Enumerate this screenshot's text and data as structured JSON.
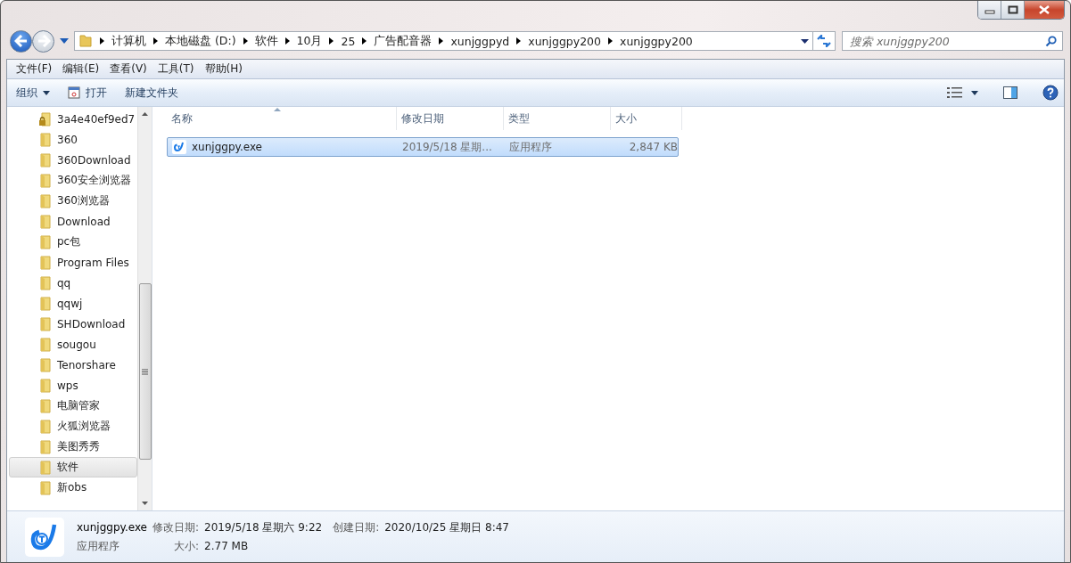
{
  "address_bar": {
    "crumbs": [
      "计算机",
      "本地磁盘 (D:)",
      "软件",
      "10月",
      "25",
      "广告配音器",
      "xunjggpyd",
      "xunjggpy200",
      "xunjggpy200"
    ]
  },
  "search": {
    "placeholder": "搜索 xunjggpy200"
  },
  "menu": [
    "文件(F)",
    "编辑(E)",
    "查看(V)",
    "工具(T)",
    "帮助(H)"
  ],
  "toolbar": [
    {
      "label": "组织",
      "kind": "dropdown"
    },
    {
      "label": "打开",
      "kind": "open"
    },
    {
      "label": "新建文件夹",
      "kind": "plain"
    }
  ],
  "sidebar": {
    "items": [
      {
        "label": "3a4e40ef9ed7",
        "kind": "locked",
        "selected": false
      },
      {
        "label": "360",
        "kind": "folder",
        "selected": false
      },
      {
        "label": "360Download",
        "kind": "folder",
        "selected": false
      },
      {
        "label": "360安全浏览器",
        "kind": "folder",
        "selected": false
      },
      {
        "label": "360浏览器",
        "kind": "folder",
        "selected": false
      },
      {
        "label": "Download",
        "kind": "folder",
        "selected": false
      },
      {
        "label": "pc包",
        "kind": "folder",
        "selected": false
      },
      {
        "label": "Program Files",
        "kind": "folder",
        "selected": false
      },
      {
        "label": "qq",
        "kind": "folder",
        "selected": false
      },
      {
        "label": "qqwj",
        "kind": "folder",
        "selected": false
      },
      {
        "label": "SHDownload",
        "kind": "folder",
        "selected": false
      },
      {
        "label": "sougou",
        "kind": "folder",
        "selected": false
      },
      {
        "label": "Tenorshare",
        "kind": "folder",
        "selected": false
      },
      {
        "label": "wps",
        "kind": "folder",
        "selected": false
      },
      {
        "label": "电脑管家",
        "kind": "folder",
        "selected": false
      },
      {
        "label": "火狐浏览器",
        "kind": "folder",
        "selected": false
      },
      {
        "label": "美图秀秀",
        "kind": "folder",
        "selected": false
      },
      {
        "label": "软件",
        "kind": "folder",
        "selected": true
      },
      {
        "label": "新obs",
        "kind": "folder",
        "selected": false
      }
    ]
  },
  "table": {
    "columns": [
      "名称",
      "修改日期",
      "类型",
      "大小"
    ],
    "rows": [
      {
        "name": "xunjggpy.exe",
        "modified": "2019/5/18 星期...",
        "type": "应用程序",
        "size": "2,847 KB",
        "selected": true
      }
    ]
  },
  "details": {
    "file_name": "xunjggpy.exe",
    "file_type": "应用程序",
    "fields": [
      {
        "label": "修改日期:",
        "value": "2019/5/18 星期六 9:22"
      },
      {
        "label": "创建日期:",
        "value": "2020/10/25 星期日 8:47"
      },
      {
        "label": "大小:",
        "value": "2.77 MB"
      }
    ]
  }
}
